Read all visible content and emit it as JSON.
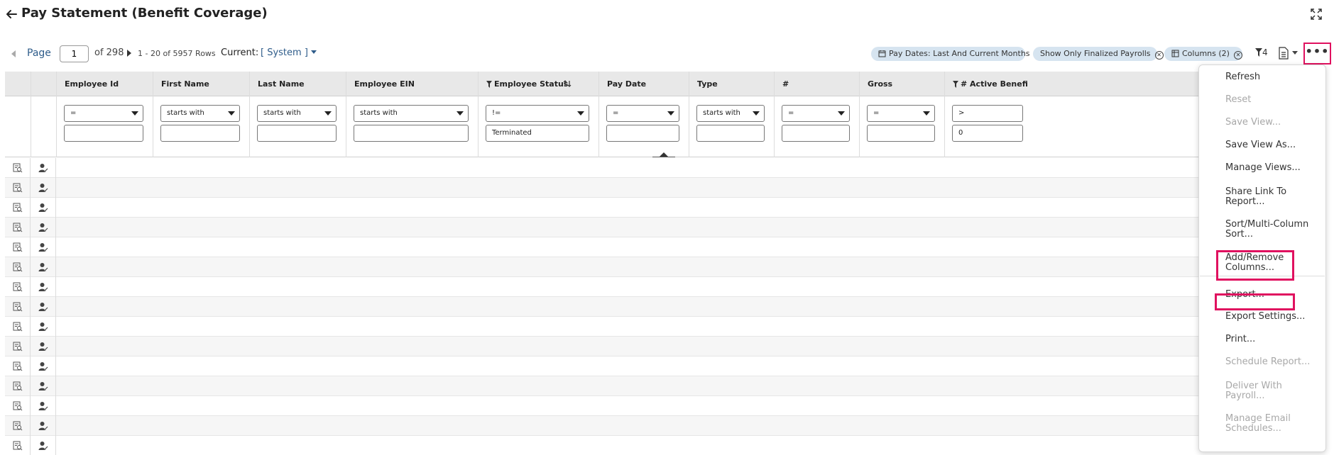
{
  "header": {
    "title": "Pay Statement (Benefit Coverage)",
    "back_icon": "arrow-left-icon",
    "expand_icon": "fullscreen-icon"
  },
  "toolbar": {
    "page_label": "Page",
    "page_value": "1",
    "of_pages": "of 298",
    "rows_info": "1 - 20 of 5957 Rows",
    "current_label": "Current:",
    "current_view": "[ System ]",
    "chips": [
      {
        "label": "Pay Dates: Last And Current Months",
        "removable": false
      },
      {
        "label": "Show Only Finalized Payrolls",
        "removable": true
      },
      {
        "label": "Columns (2)",
        "removable": true
      }
    ],
    "filter_count": "4",
    "more_label": "•••"
  },
  "columns": [
    {
      "label": "Employee Id",
      "op": "=",
      "value": ""
    },
    {
      "label": "First Name",
      "op": "starts with",
      "value": ""
    },
    {
      "label": "Last Name",
      "op": "starts with",
      "value": ""
    },
    {
      "label": "Employee EIN",
      "op": "starts with",
      "value": ""
    },
    {
      "label": "Employee Status",
      "op": "!=",
      "value": "Terminated",
      "filtered": true,
      "sorted": true
    },
    {
      "label": "Pay Date",
      "op": "=",
      "value": ""
    },
    {
      "label": "Type",
      "op": "starts with",
      "value": ""
    },
    {
      "label": "#",
      "op": "=",
      "value": ""
    },
    {
      "label": "Gross",
      "op": "=",
      "value": ""
    },
    {
      "label": "# Active Benefi",
      "op": ">",
      "value": "0",
      "filtered": true
    }
  ],
  "row_count": 15,
  "menu": {
    "items": [
      {
        "label": "Refresh",
        "enabled": true
      },
      {
        "label": "Reset",
        "enabled": false
      },
      {
        "label": "Save View...",
        "enabled": false
      },
      {
        "label": "Save View As...",
        "enabled": true
      },
      {
        "label": "Manage Views...",
        "enabled": true
      },
      {
        "label": "Share Link To Report...",
        "enabled": true
      },
      {
        "label": "Sort/Multi-Column Sort...",
        "enabled": true
      },
      {
        "label": "Add/Remove Columns...",
        "enabled": true,
        "highlighted": true
      },
      {
        "label": "Export...",
        "enabled": true,
        "highlighted": true
      },
      {
        "label": "Export Settings...",
        "enabled": true
      },
      {
        "label": "Print...",
        "enabled": true
      },
      {
        "label": "Schedule Report...",
        "enabled": false
      },
      {
        "label": "Deliver With Payroll...",
        "enabled": false
      },
      {
        "label": "Manage Email Schedules...",
        "enabled": false
      }
    ]
  },
  "colors": {
    "accent": "#2e5c8a",
    "chip_bg": "#d6e4f0",
    "highlight": "#e0115f",
    "header_bg": "#e8e8e8"
  }
}
